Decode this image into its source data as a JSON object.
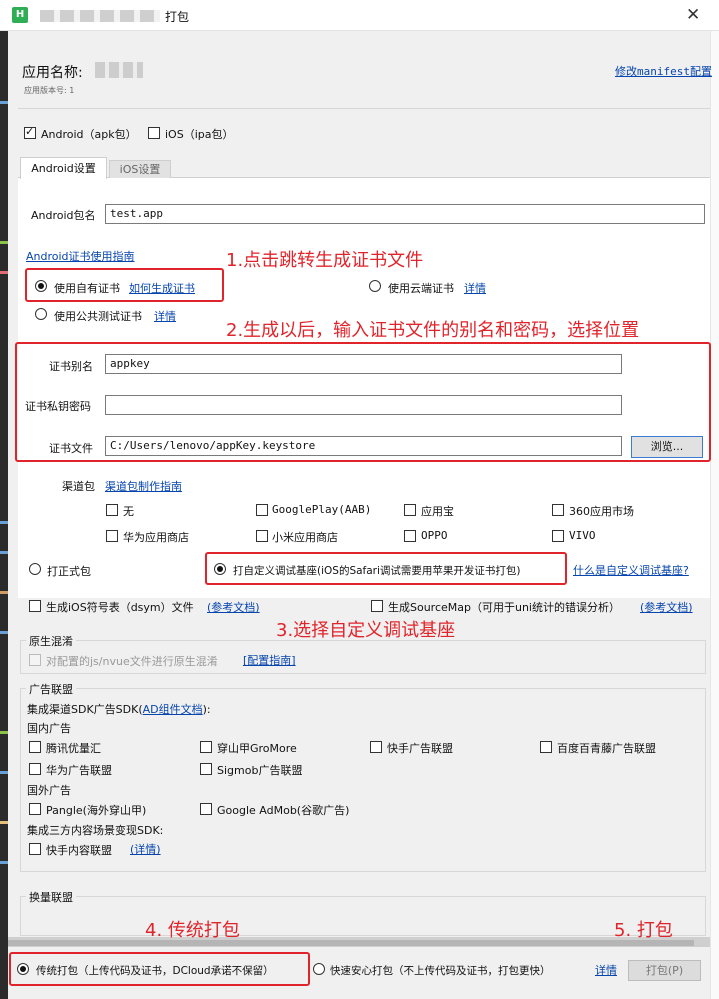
{
  "window": {
    "title_suffix": "打包",
    "close_glyph": "✕",
    "icon_letter": "H"
  },
  "header": {
    "app_name_label": "应用名称:",
    "app_version_label": "应用版本号: 1",
    "edit_manifest_link": "修改manifest配置"
  },
  "platforms": {
    "android": {
      "label": "Android（apk包）",
      "checked": true
    },
    "ios": {
      "label": "iOS（ipa包）",
      "checked": false
    }
  },
  "tabs": [
    {
      "label": "Android设置",
      "active": true
    },
    {
      "label": "iOS设置",
      "active": false
    }
  ],
  "android": {
    "package_label": "Android包名",
    "package_value": "test.app",
    "cert_guide_link": "Android证书使用指南",
    "own_cert_label": "使用自有证书",
    "own_cert_link": "如何生成证书",
    "cloud_cert_label": "使用云端证书",
    "cloud_cert_link": "详情",
    "public_cert_label": "使用公共测试证书",
    "public_cert_link": "详情",
    "alias_label": "证书别名",
    "alias_value": "appkey",
    "password_label": "证书私钥密码",
    "password_value": "",
    "file_label": "证书文件",
    "file_value": "C:/Users/lenovo/appKey.keystore",
    "browse_button": "浏览..."
  },
  "channels": {
    "label": "渠道包",
    "guide_link": "渠道包制作指南",
    "items": [
      {
        "label": "无"
      },
      {
        "label": "GooglePlay(AAB)"
      },
      {
        "label": "应用宝"
      },
      {
        "label": "360应用市场"
      },
      {
        "label": "华为应用商店"
      },
      {
        "label": "小米应用商店"
      },
      {
        "label": "OPPO"
      },
      {
        "label": "VIVO"
      }
    ]
  },
  "package_type": {
    "formal_label": "打正式包",
    "custom_label": "打自定义调试基座(iOS的Safari调试需要用苹果开发证书打包)",
    "what_is_link": "什么是自定义调试基座?"
  },
  "options": {
    "dsym_label": "生成iOS符号表（dsym）文件",
    "dsym_link": "(参考文档)",
    "sourcemap_label": "生成SourceMap（可用于uni统计的错误分析）",
    "sourcemap_link": "(参考文档)"
  },
  "obfuscation": {
    "title": "原生混淆",
    "option_label": "对配置的js/nvue文件进行原生混淆",
    "guide_link": "[配置指南]"
  },
  "ads": {
    "title": "广告联盟",
    "sdk_label_prefix": "集成渠道SDK广告SDK(",
    "sdk_link": "AD组件文档",
    "sdk_label_suffix": "):",
    "domestic_title": "国内广告",
    "domestic": [
      {
        "label": "腾讯优量汇"
      },
      {
        "label": "穿山甲GroMore"
      },
      {
        "label": "快手广告联盟"
      },
      {
        "label": "百度百青藤广告联盟"
      },
      {
        "label": "华为广告联盟"
      },
      {
        "label": "Sigmob广告联盟"
      }
    ],
    "foreign_title": "国外广告",
    "foreign": [
      {
        "label": "Pangle(海外穿山甲)"
      },
      {
        "label": "Google AdMob(谷歌广告)"
      }
    ],
    "content_title": "集成三方内容场景变现SDK:",
    "content": [
      {
        "label": "快手内容联盟",
        "link": "(详情)"
      }
    ]
  },
  "exchange": {
    "title": "换量联盟"
  },
  "footer": {
    "traditional_label": "传统打包（上传代码及证书，DCloud承诺不保留）",
    "secure_label": "快速安心打包（不上传代码及证书，打包更快）",
    "details_link": "详情",
    "pack_button": "打包(P)"
  },
  "annotations": {
    "step1": "1.点击跳转生成证书文件",
    "step2": "2.生成以后，输入证书文件的别名和密码，选择位置",
    "step3": "3.选择自定义调试基座",
    "step4": "4. 传统打包",
    "step5": "5. 打包"
  },
  "colors": {
    "annotation_red": "#e0242b",
    "link_blue": "#0645ad",
    "hbuilder_green": "#2fae55"
  }
}
